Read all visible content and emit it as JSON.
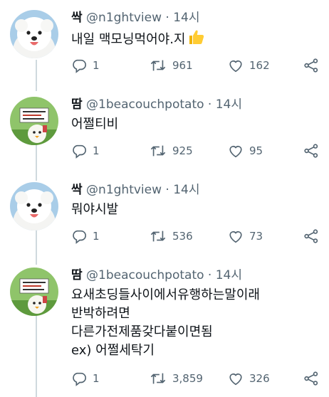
{
  "tweets": [
    {
      "author": "싹",
      "handle": "@n1ghtview",
      "separator": "·",
      "time": "14시",
      "avatar": "white-dog-avatar",
      "text_lines": [
        "내일 맥모닝먹어야.지"
      ],
      "emoji": "thumbs-up-emoji",
      "replies": "1",
      "retweets": "961",
      "likes": "162"
    },
    {
      "author": "땀",
      "handle": "@1beacouchpotato",
      "separator": "·",
      "time": "14시",
      "avatar": "sign-chick-avatar",
      "text_lines": [
        "어쩔티비"
      ],
      "replies": "1",
      "retweets": "925",
      "likes": "95"
    },
    {
      "author": "싹",
      "handle": "@n1ghtview",
      "separator": "·",
      "time": "14시",
      "avatar": "white-dog-avatar",
      "text_lines": [
        "뭐야시발"
      ],
      "replies": "1",
      "retweets": "536",
      "likes": "73"
    },
    {
      "author": "땀",
      "handle": "@1beacouchpotato",
      "separator": "·",
      "time": "14시",
      "avatar": "sign-chick-avatar",
      "text_lines": [
        "요새초딩들사이에서유행하는말이래",
        "반박하려면",
        "다른가전제품갖다붙이면됨",
        "ex) 어쩔세탁기"
      ],
      "replies": "1",
      "retweets": "3,859",
      "likes": "326"
    }
  ],
  "colors": {
    "text": "#0f1419",
    "secondary": "#536471",
    "thread_line": "#cfd9de"
  },
  "icons": {
    "reply": "reply-icon",
    "retweet": "retweet-icon",
    "like": "heart-icon",
    "share": "share-icon"
  }
}
